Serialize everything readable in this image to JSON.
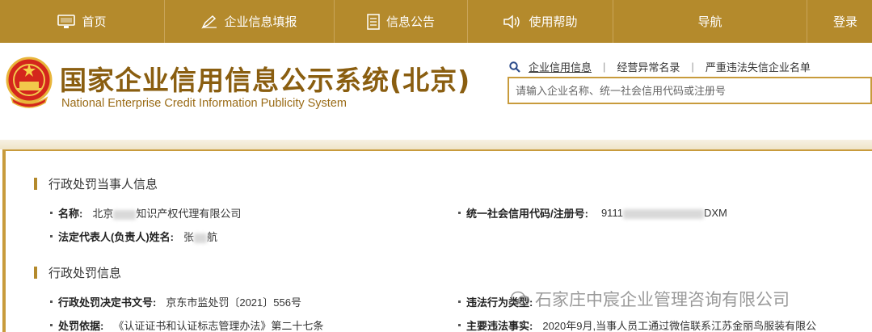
{
  "nav": {
    "home": "首页",
    "fill": "企业信息填报",
    "notice": "信息公告",
    "help": "使用帮助",
    "guide": "导航",
    "login": "登录"
  },
  "header": {
    "title": "国家企业信用信息公示系统(北京)",
    "subtitle": "National Enterprise Credit Information Publicity System",
    "links": [
      "企业信用信息",
      "经营异常名录",
      "严重违法失信企业名单"
    ],
    "search_placeholder": "请输入企业名称、统一社会信用代码或注册号"
  },
  "party_section": {
    "title": "行政处罚当事人信息",
    "name_label": "名称:",
    "name_prefix": "北京",
    "name_suffix": "知识产权代理有限公司",
    "code_label": "统一社会信用代码/注册号:",
    "code_prefix": "9111",
    "code_suffix": "DXM",
    "rep_label": "法定代表人(负责人)姓名:",
    "rep_prefix": "张",
    "rep_suffix": "航"
  },
  "penalty_section": {
    "title": "行政处罚信息",
    "doc_label": "行政处罚决定书文号:",
    "doc_value": "京东市监处罚〔2021〕556号",
    "type_label": "违法行为类型:",
    "basis_label": "处罚依据:",
    "basis_value": "《认证证书和认证标志管理办法》第二十七条",
    "facts_label": "主要违法事实:",
    "facts_value": "2020年9月,当事人员工通过微信联系江苏金丽鸟服装有限公"
  },
  "watermark": "石家庄中宸企业管理咨询有限公司",
  "colors": {
    "nav_bg": "#b48a2c",
    "title": "#8a5e10",
    "accent": "#c89b3c"
  }
}
